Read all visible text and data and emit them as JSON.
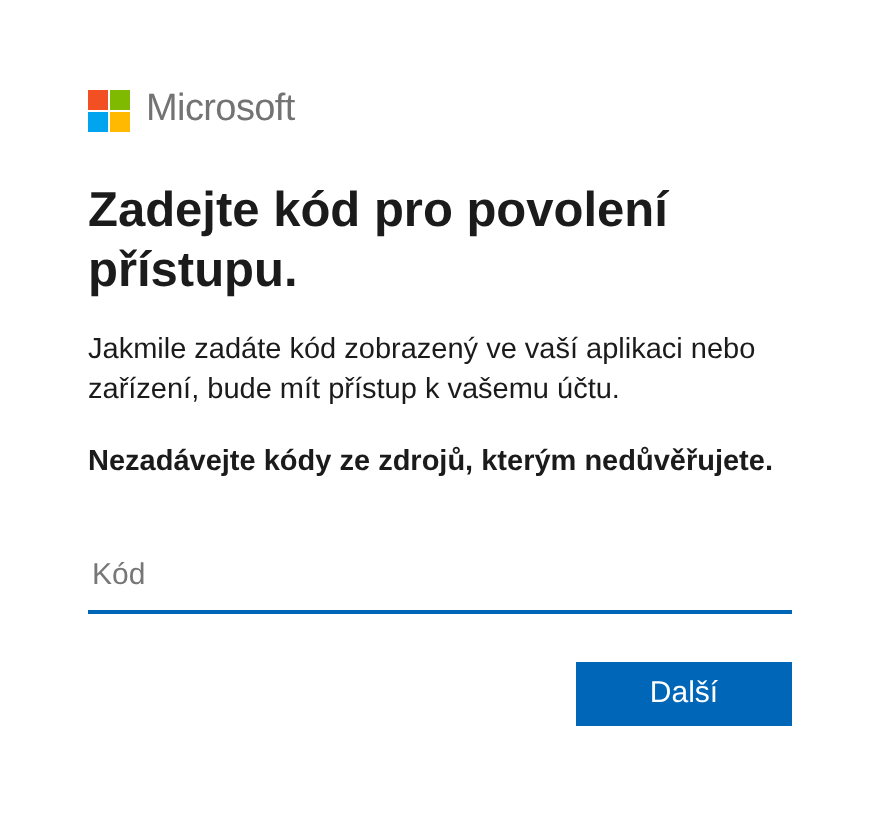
{
  "logo": {
    "name": "Microsoft"
  },
  "title": "Zadejte kód pro povolení přístupu.",
  "description": "Jakmile zadáte kód zobrazený ve vaší aplikaci nebo zařízení, bude mít přístup k vašemu účtu.",
  "warning": "Nezadávejte kódy ze zdrojů, kterým nedůvěřujete.",
  "code_field": {
    "placeholder": "Kód",
    "focused": true
  },
  "buttons": [
    {
      "label": "Další",
      "kind": "primary"
    }
  ]
}
